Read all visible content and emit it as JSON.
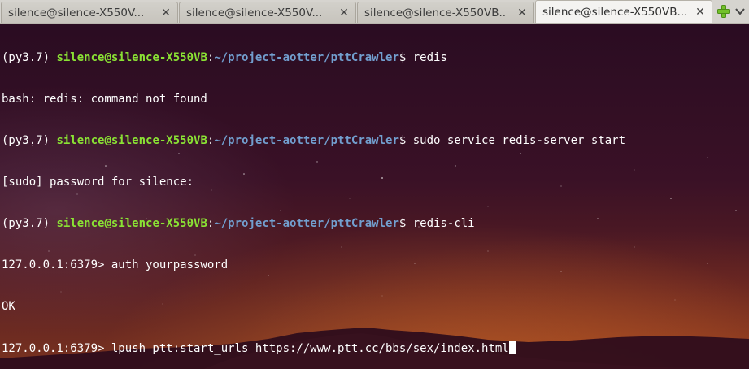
{
  "tabs": [
    {
      "label": "silence@silence-X550V...",
      "close": "✕",
      "active": false
    },
    {
      "label": "silence@silence-X550V...",
      "close": "✕",
      "active": false
    },
    {
      "label": "silence@silence-X550VB...",
      "close": "✕",
      "active": false
    },
    {
      "label": "silence@silence-X550VB...",
      "close": "✕",
      "active": true
    }
  ],
  "toolbar": {
    "new_tab_icon": "plus-icon",
    "tab_scroll_icon": "chevron-down-icon"
  },
  "colors": {
    "user_host": "#8ae234",
    "path": "#729fcf",
    "text": "#ffffff"
  },
  "terminal": {
    "lines": [
      {
        "env": "(py3.7) ",
        "user": "silence@silence-X550VB",
        "sep": ":",
        "path": "~/project-aotter/pttCrawler",
        "prompt": "$ ",
        "command": "redis"
      },
      {
        "text": "bash: redis: command not found"
      },
      {
        "env": "(py3.7) ",
        "user": "silence@silence-X550VB",
        "sep": ":",
        "path": "~/project-aotter/pttCrawler",
        "prompt": "$ ",
        "command": "sudo service redis-server start"
      },
      {
        "text": "[sudo] password for silence:"
      },
      {
        "env": "(py3.7) ",
        "user": "silence@silence-X550VB",
        "sep": ":",
        "path": "~/project-aotter/pttCrawler",
        "prompt": "$ ",
        "command": "redis-cli"
      },
      {
        "text": "127.0.0.1:6379> auth yourpassword"
      },
      {
        "text": "OK"
      },
      {
        "text": "127.0.0.1:6379> lpush ptt:start_urls https://www.ptt.cc/bbs/sex/index.html"
      }
    ]
  }
}
